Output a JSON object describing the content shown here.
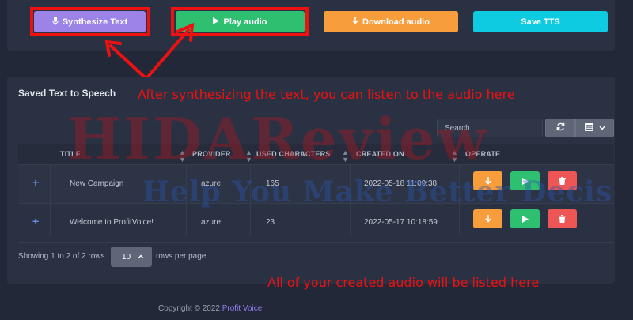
{
  "toolbar": {
    "synthesize_label": "Synthesize Text",
    "play_label": "Play audio",
    "download_label": "Download audio",
    "save_label": "Save TTS"
  },
  "saved": {
    "title": "Saved Text to Speech",
    "search_placeholder": "Search",
    "columns": [
      "TITLE",
      "PROVIDER",
      "USED CHARACTERS",
      "CREATED ON",
      "OPERATE"
    ],
    "rows": [
      {
        "title": "New Campaign",
        "provider": "azure",
        "used_characters": "165",
        "created_on": "2022-05-18 11:09:38"
      },
      {
        "title": "Welcome to ProfitVoice!",
        "provider": "azure",
        "used_characters": "23",
        "created_on": "2022-05-17 10:18:59"
      }
    ],
    "showing": "Showing 1 to 2 of 2 rows",
    "page_size": "10",
    "rows_per_page": "rows per page"
  },
  "annotations": {
    "listen_note": "After synthesizing the text, you can listen to the audio here",
    "list_note": "All of your created audio will be listed here"
  },
  "watermark": {
    "main": "HIDAReview",
    "sub": "Help You Make Better Decis"
  },
  "footer": {
    "copyright": "Copyright © 2022",
    "brand": "Profit Voice"
  },
  "colors": {
    "synthesize": "#9b83e8",
    "play": "#2fbf71",
    "download": "#f79d3c",
    "save": "#0fcbe2",
    "delete": "#ee5656",
    "annotation": "#ee1111"
  }
}
